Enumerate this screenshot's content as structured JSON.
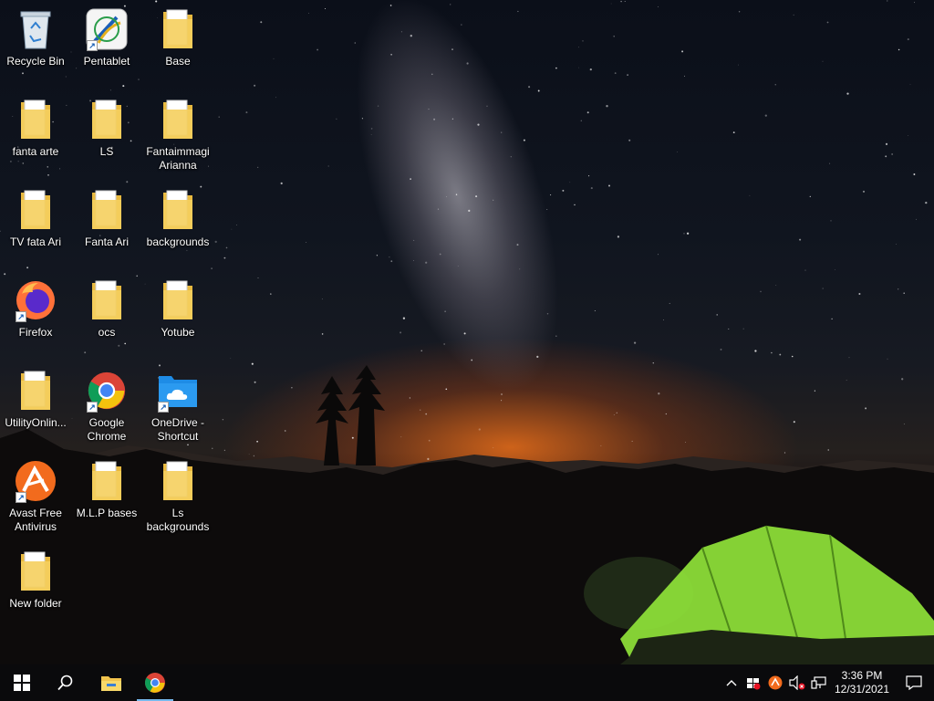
{
  "desktop": {
    "icons": [
      {
        "id": "recycle-bin",
        "label": "Recycle Bin",
        "icon": "recycle-bin-icon"
      },
      {
        "id": "pentablet",
        "label": "Pentablet",
        "icon": "pentablet-app-icon",
        "shortcut": true
      },
      {
        "id": "base",
        "label": "Base",
        "icon": "folder-icon"
      },
      {
        "id": "fanta-arte",
        "label": "fanta arte",
        "icon": "folder-icon"
      },
      {
        "id": "ls",
        "label": "LS",
        "icon": "folder-icon"
      },
      {
        "id": "fantaimmagi",
        "label": "Fantaimmagi Arianna",
        "icon": "folder-icon"
      },
      {
        "id": "tv-fata-ari",
        "label": "TV  fata Ari",
        "icon": "folder-icon"
      },
      {
        "id": "fanta-ari",
        "label": "Fanta Ari",
        "icon": "folder-icon"
      },
      {
        "id": "backgrounds",
        "label": "backgrounds",
        "icon": "folder-icon"
      },
      {
        "id": "firefox",
        "label": "Firefox",
        "icon": "firefox-icon",
        "shortcut": true
      },
      {
        "id": "ocs",
        "label": "ocs",
        "icon": "folder-icon"
      },
      {
        "id": "yotube",
        "label": "Yotube",
        "icon": "folder-icon"
      },
      {
        "id": "utilityonline",
        "label": "UtilityOnlin...",
        "icon": "folder-icon"
      },
      {
        "id": "google-chrome",
        "label": "Google Chrome",
        "icon": "chrome-icon",
        "shortcut": true
      },
      {
        "id": "onedrive",
        "label": "OneDrive - Shortcut",
        "icon": "onedrive-folder-icon",
        "shortcut": true
      },
      {
        "id": "avast",
        "label": "Avast Free Antivirus",
        "icon": "avast-icon",
        "shortcut": true
      },
      {
        "id": "mlp-bases",
        "label": "M.L.P bases",
        "icon": "folder-icon"
      },
      {
        "id": "ls-backgrounds",
        "label": "Ls backgrounds",
        "icon": "folder-icon"
      },
      {
        "id": "new-folder",
        "label": "New folder",
        "icon": "folder-icon"
      }
    ]
  },
  "taskbar": {
    "start": {
      "icon": "windows-start-icon"
    },
    "search": {
      "icon": "search-icon"
    },
    "pinned": [
      {
        "id": "file-explorer",
        "icon": "file-explorer-icon",
        "active": false
      },
      {
        "id": "chrome",
        "icon": "chrome-icon",
        "active": true
      }
    ],
    "tray": {
      "icons": [
        "chevron-up-icon",
        "security-icon",
        "avast-tray-icon",
        "volume-muted-icon",
        "network-icon"
      ],
      "time": "3:36 PM",
      "date": "12/31/2021",
      "notifications_icon": "action-center-icon"
    }
  },
  "colors": {
    "taskbar_bg": "#0a0a0c",
    "active_indicator": "#76b9ed",
    "folder_yellow": "#f5cf5e",
    "tent_green": "#8fe33a",
    "horizon_orange": "#e86a1a"
  }
}
